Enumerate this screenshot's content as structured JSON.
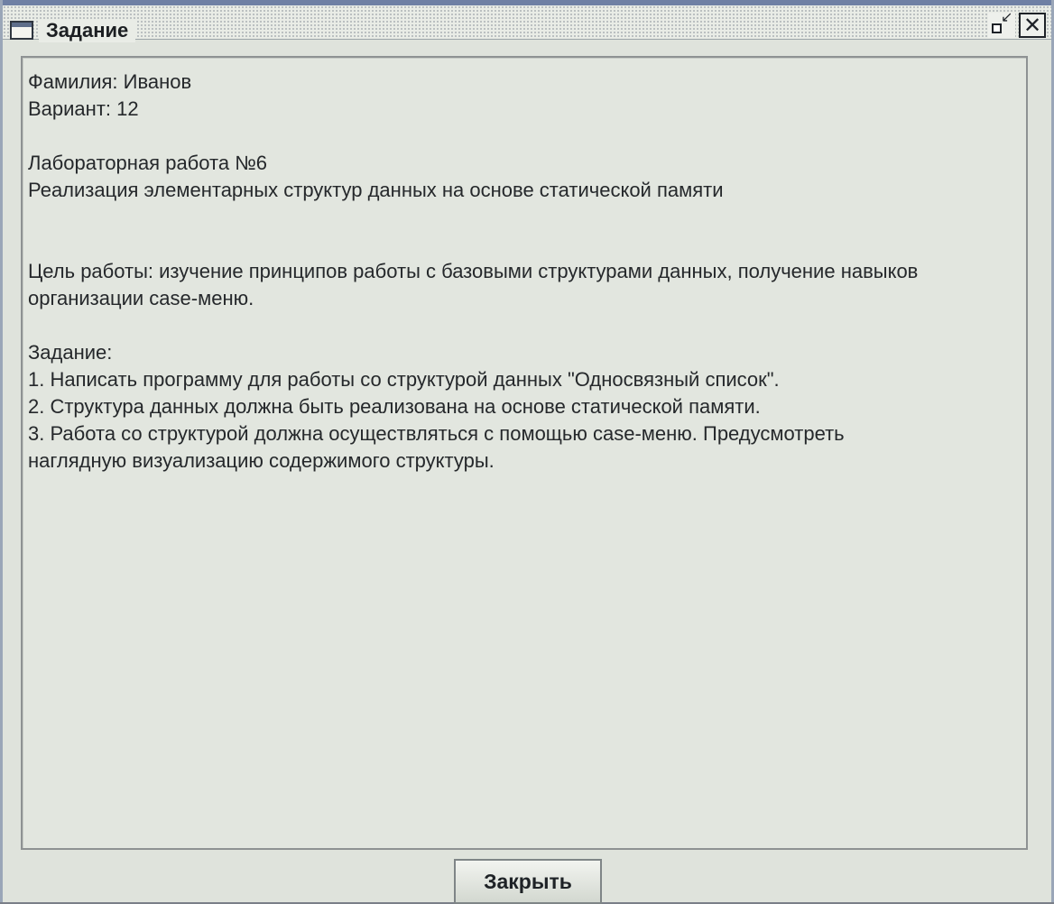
{
  "window": {
    "title": "Задание",
    "restore_symbol": "↙",
    "close_symbol": "✕"
  },
  "content": {
    "lines": [
      "Фамилия: Иванов",
      "Вариант: 12",
      "",
      "Лабораторная работа №6",
      "Реализация элементарных структур данных на основе статической памяти",
      "",
      "",
      "Цель работы: изучение принципов работы с базовыми структурами данных, получение навыков",
      "организации case-меню.",
      "",
      "Задание:",
      "1. Написать программу для работы со структурой данных \"Односвязный список\".",
      "2. Структура данных должна быть реализована на основе статической памяти.",
      "3. Работа со структурой должна осуществляться с помощью case-меню. Предусмотреть",
      "наглядную визуализацию содержимого структуры."
    ]
  },
  "buttons": {
    "close_label": "Закрыть"
  },
  "colors": {
    "titlebar_accent": "#6f80a4",
    "window_bg": "#dfe3dc",
    "text": "#25282b"
  }
}
